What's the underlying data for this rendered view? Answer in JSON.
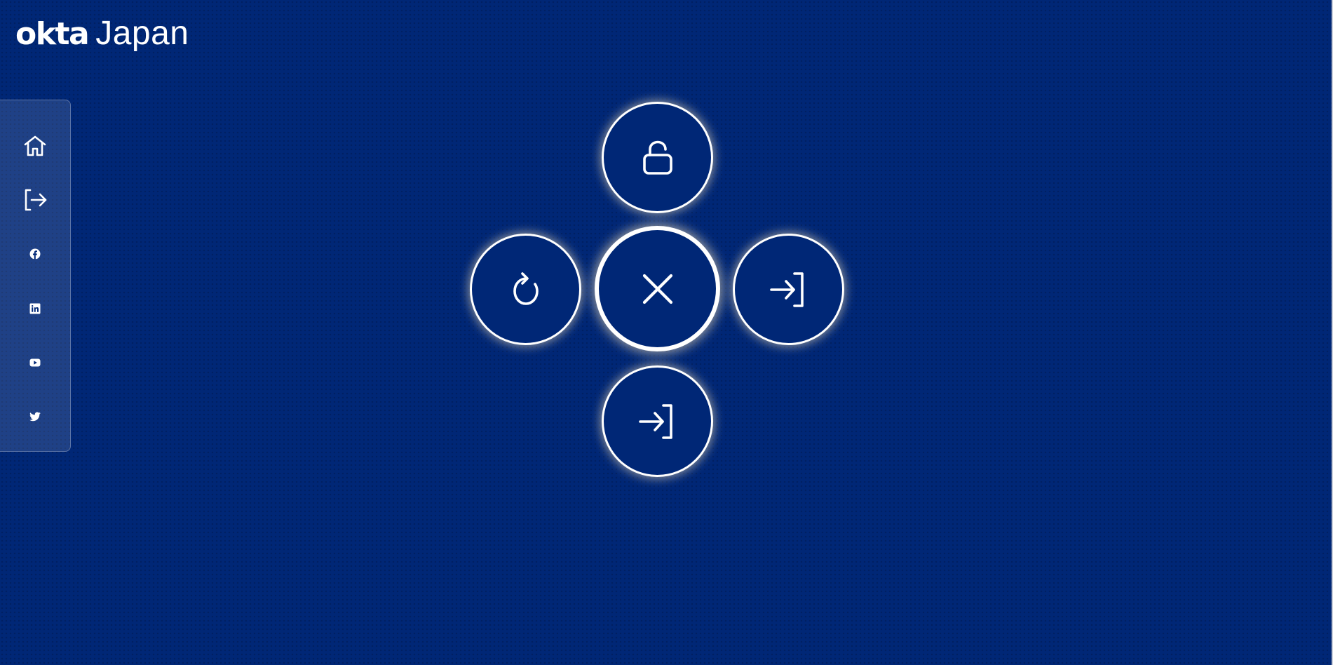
{
  "logo": {
    "wordmark": "okta",
    "region": "Japan"
  },
  "colors": {
    "background": "#002776",
    "foreground": "#ffffff",
    "button_glow": "#ffebbe"
  },
  "sidebar": {
    "items": [
      {
        "id": "home",
        "icon": "home-icon"
      },
      {
        "id": "sign-out",
        "icon": "sign-out-icon"
      },
      {
        "id": "facebook",
        "icon": "facebook-icon"
      },
      {
        "id": "linkedin",
        "icon": "linkedin-icon"
      },
      {
        "id": "youtube",
        "icon": "youtube-icon"
      },
      {
        "id": "twitter",
        "icon": "twitter-icon"
      }
    ]
  },
  "actions": {
    "top": {
      "icon": "unlock-icon"
    },
    "left": {
      "icon": "refresh-icon"
    },
    "center": {
      "icon": "close-icon"
    },
    "right": {
      "icon": "sign-in-icon"
    },
    "bottom": {
      "icon": "sign-in-icon"
    }
  }
}
